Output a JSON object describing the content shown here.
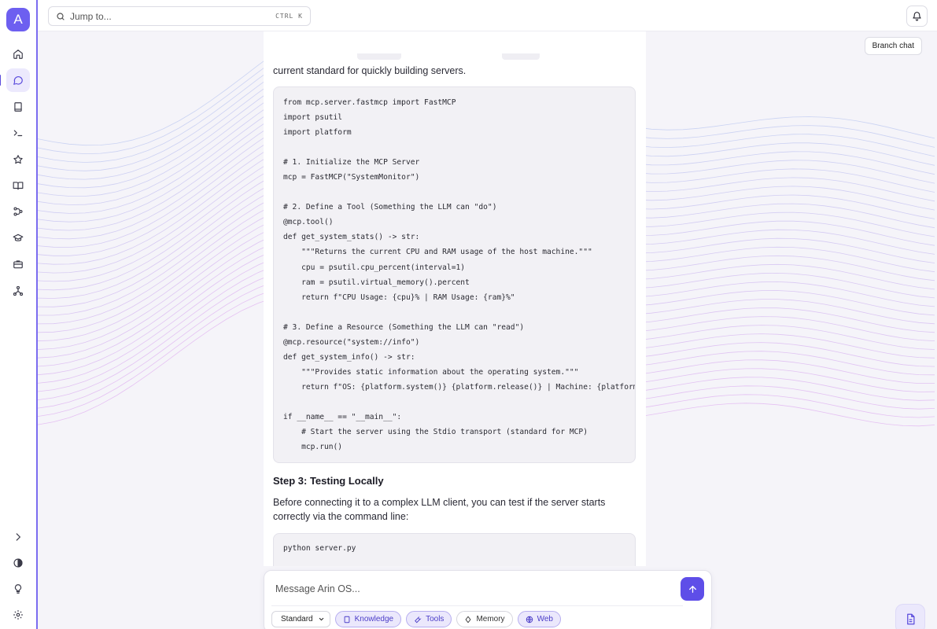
{
  "app": {
    "logo_letter": "A",
    "accent_color": "#6d5ff0"
  },
  "sidebar": {
    "items": [
      {
        "name": "home-icon",
        "active": false
      },
      {
        "name": "chat-icon",
        "active": true
      },
      {
        "name": "book-icon",
        "active": false
      },
      {
        "name": "terminal-icon",
        "active": false
      },
      {
        "name": "star-icon",
        "active": false
      },
      {
        "name": "library-icon",
        "active": false
      },
      {
        "name": "workflow-icon",
        "active": false
      },
      {
        "name": "graduation-cap-icon",
        "active": false
      },
      {
        "name": "briefcase-icon",
        "active": false
      },
      {
        "name": "network-icon",
        "active": false
      }
    ],
    "bottom": [
      "expand-icon",
      "theme-contrast-icon",
      "lightbulb-icon",
      "settings-icon"
    ]
  },
  "topbar": {
    "search_placeholder": "Jump to...",
    "search_shortcut": "CTRL K",
    "branch_label": "Branch chat"
  },
  "message": {
    "intro_line": "current standard for quickly building servers.",
    "code_block_1": [
      "from mcp.server.fastmcp import FastMCP",
      "import psutil",
      "import platform",
      "",
      "# 1. Initialize the MCP Server",
      "mcp = FastMCP(\"SystemMonitor\")",
      "",
      "# 2. Define a Tool (Something the LLM can \"do\")",
      "@mcp.tool()",
      "def get_system_stats() -> str:",
      "    \"\"\"Returns the current CPU and RAM usage of the host machine.\"\"\"",
      "    cpu = psutil.cpu_percent(interval=1)",
      "    ram = psutil.virtual_memory().percent",
      "    return f\"CPU Usage: {cpu}% | RAM Usage: {ram}%\"",
      "",
      "# 3. Define a Resource (Something the LLM can \"read\")",
      "@mcp.resource(\"system://info\")",
      "def get_system_info() -> str:",
      "    \"\"\"Provides static information about the operating system.\"\"\"",
      "    return f\"OS: {platform.system()} {platform.release()} | Machine: {platform.machine()}\"",
      "",
      "if __name__ == \"__main__\":",
      "    # Start the server using the Stdio transport (standard for MCP)",
      "    mcp.run()"
    ],
    "step3_heading": "Step 3: Testing Locally",
    "step3_para": "Before connecting it to a complex LLM client, you can test if the server starts correctly via the command line:",
    "code_block_2": [
      "python server.py"
    ]
  },
  "composer": {
    "placeholder": "Message Arin OS...",
    "mode_selected": "Standard",
    "chips": [
      {
        "label": "Knowledge",
        "icon": "book-icon",
        "on": true
      },
      {
        "label": "Tools",
        "icon": "wrench-icon",
        "on": true
      },
      {
        "label": "Memory",
        "icon": "brain-icon",
        "on": false
      },
      {
        "label": "Web",
        "icon": "globe-icon",
        "on": true
      }
    ]
  }
}
